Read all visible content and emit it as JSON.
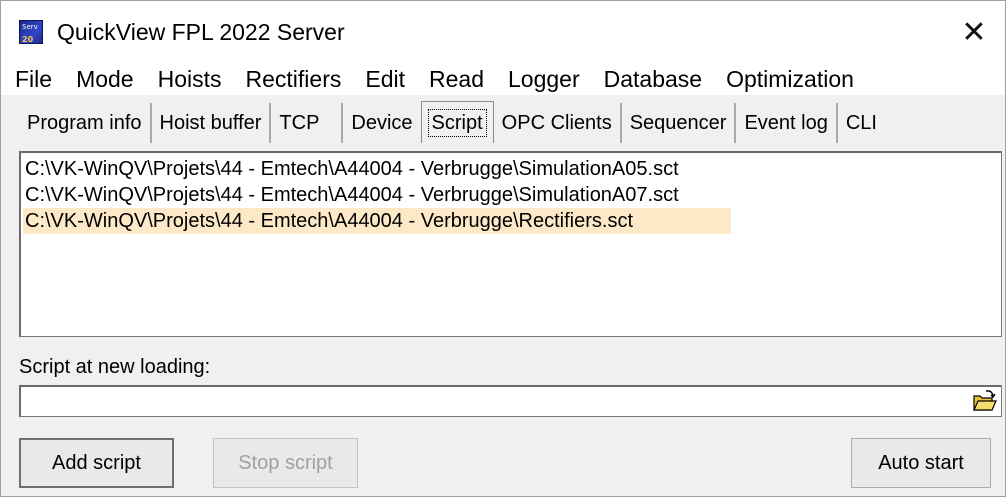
{
  "window": {
    "title": "QuickView FPL 2022 Server",
    "icon_top_text": "Serv",
    "icon_bottom_text": "20"
  },
  "menu": [
    "File",
    "Mode",
    "Hoists",
    "Rectifiers",
    "Edit",
    "Read",
    "Logger",
    "Database",
    "Optimization"
  ],
  "tabs": [
    "Program info",
    "Hoist buffer",
    "TCP",
    "Device",
    "Script",
    "OPC Clients",
    "Sequencer",
    "Event log",
    "CLI"
  ],
  "active_tab": "Script",
  "scripts": [
    "C:\\VK-WinQV\\Projets\\44 - Emtech\\A44004 - Verbrugge\\SimulationA05.sct",
    "C:\\VK-WinQV\\Projets\\44 - Emtech\\A44004 - Verbrugge\\SimulationA07.sct",
    "C:\\VK-WinQV\\Projets\\44 - Emtech\\A44004 - Verbrugge\\Rectifiers.sct"
  ],
  "selected_script_index": 2,
  "new_loading": {
    "label": "Script at new loading:",
    "value": ""
  },
  "buttons": {
    "add": "Add script",
    "stop": "Stop script",
    "auto": "Auto start"
  },
  "colors": {
    "selection": "#fde9c7",
    "window_bg": "#f0f0f0"
  },
  "icons": {
    "close": "close-icon",
    "folder": "open-folder-icon",
    "app": "app-icon"
  }
}
